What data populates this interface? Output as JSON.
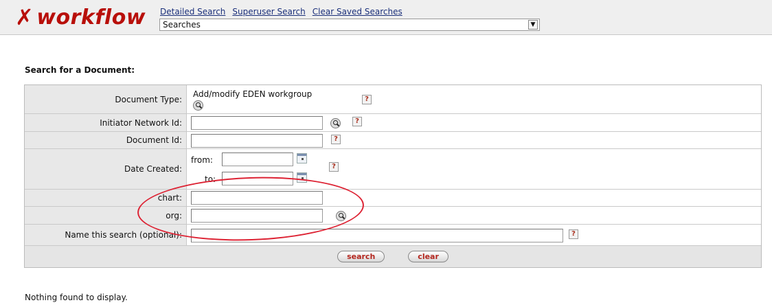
{
  "header": {
    "logo_text": "workflow",
    "links": [
      "Detailed Search",
      "Superuser Search",
      "Clear Saved Searches"
    ],
    "searches_select_value": "Searches"
  },
  "section_title": "Search for a Document:",
  "form": {
    "document_type_label": "Document Type:",
    "document_type_value": "Add/modify EDEN workgroup",
    "initiator_label": "Initiator Network Id:",
    "document_id_label": "Document Id:",
    "date_created_label": "Date Created:",
    "from_label": "from:",
    "to_label": "to:",
    "chart_label": "chart:",
    "org_label": "org:",
    "name_search_label": "Name this search (optional):",
    "help_glyph": "?"
  },
  "buttons": {
    "search": "search",
    "clear": "clear"
  },
  "status_text": "Nothing found to display.",
  "colors": {
    "logo_red": "#b80f0a",
    "annotation_red": "#d22233",
    "link_blue": "#1a2f7a"
  }
}
